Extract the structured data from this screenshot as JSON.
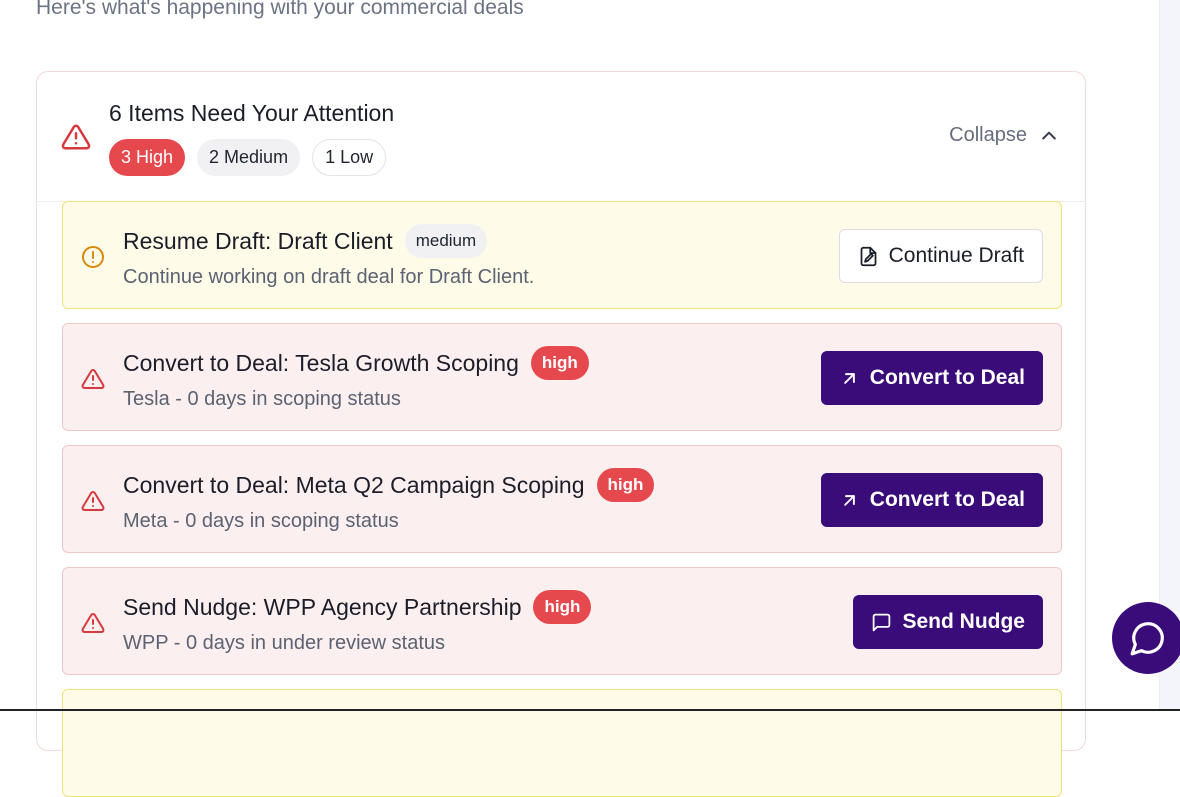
{
  "header": {
    "subtitle": "Here's what's happening with your commercial deals"
  },
  "attention": {
    "title": "6 Items Need Your Attention",
    "counts": {
      "high": "3 High",
      "medium": "2 Medium",
      "low": "1 Low"
    },
    "collapse_label": "Collapse",
    "items": [
      {
        "priority": "medium",
        "title": "Resume Draft: Draft Client",
        "badge": "medium",
        "description": "Continue working on draft deal for Draft Client.",
        "action": "Continue Draft",
        "icon": "alert-circle-icon"
      },
      {
        "priority": "high",
        "title": "Convert to Deal: Tesla Growth Scoping",
        "badge": "high",
        "description": "Tesla - 0 days in scoping status",
        "action": "Convert to Deal",
        "icon": "warning-triangle-icon"
      },
      {
        "priority": "high",
        "title": "Convert to Deal: Meta Q2 Campaign Scoping",
        "badge": "high",
        "description": "Meta - 0 days in scoping status",
        "action": "Convert to Deal",
        "icon": "warning-triangle-icon"
      },
      {
        "priority": "high",
        "title": "Send Nudge: WPP Agency Partnership",
        "badge": "high",
        "description": "WPP - 0 days in under review status",
        "action": "Send Nudge",
        "icon": "warning-triangle-icon"
      }
    ]
  },
  "colors": {
    "accent": "#3a0c7a",
    "high": "#e5484d",
    "medium_bg": "#fefbe8",
    "high_bg": "#fcefef"
  }
}
